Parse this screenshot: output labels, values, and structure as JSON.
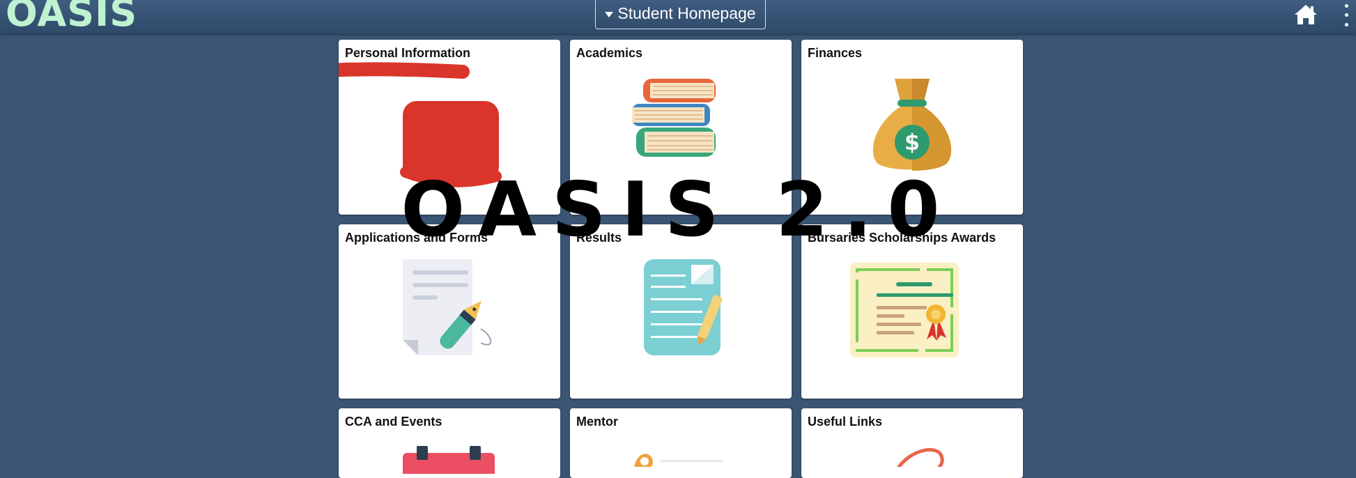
{
  "header": {
    "logo_text": "OASIS",
    "page_switcher_label": "Student Homepage",
    "home_icon": "home-icon",
    "menu_icon": "kebab-menu-icon"
  },
  "overlay": {
    "title": "OASIS 2.0"
  },
  "tiles": [
    {
      "title": "Personal Information",
      "icon": "redacted"
    },
    {
      "title": "Academics",
      "icon": "books-icon"
    },
    {
      "title": "Finances",
      "icon": "money-bag-icon"
    },
    {
      "title": "Applications and Forms",
      "icon": "document-pen-icon"
    },
    {
      "title": "Results",
      "icon": "report-icon"
    },
    {
      "title": "Bursaries Scholarships Awards",
      "icon": "certificate-icon"
    },
    {
      "title": "CCA and Events",
      "icon": "calendar-icon"
    },
    {
      "title": "Mentor",
      "icon": "mentor-icon"
    },
    {
      "title": "Useful Links",
      "icon": "link-icon"
    }
  ],
  "colors": {
    "background": "#3b5575",
    "header": "#34506f",
    "logo": "#bff2d0",
    "redaction": "#d9352b"
  }
}
